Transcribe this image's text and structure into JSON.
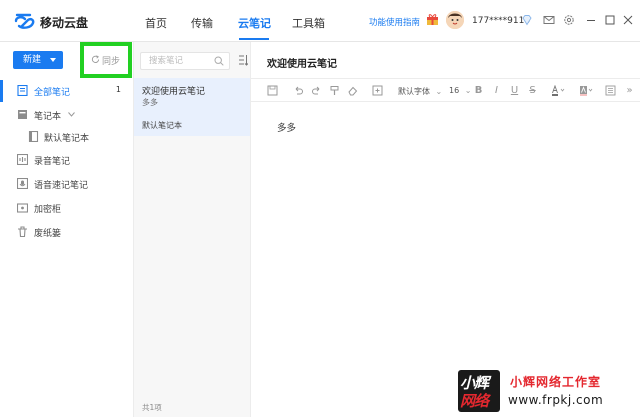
{
  "app": {
    "title": "移动云盘",
    "tabs": [
      {
        "label": "首页"
      },
      {
        "label": "传输"
      },
      {
        "label": "云笔记"
      },
      {
        "label": "工具箱"
      }
    ],
    "guide_label": "功能使用指南",
    "phone": "177****9116",
    "accent_color": "#1a7bf0"
  },
  "sidebar": {
    "new_label": "新建",
    "sync_label": "同步",
    "items": [
      {
        "label": "全部笔记",
        "count": "1"
      },
      {
        "label": "笔记本"
      },
      {
        "label": "默认笔记本"
      },
      {
        "label": "录音笔记"
      },
      {
        "label": "语音速记笔记"
      },
      {
        "label": "加密柜"
      },
      {
        "label": "废纸篓"
      }
    ]
  },
  "list": {
    "search_placeholder": "搜索笔记",
    "notes": [
      {
        "title": "欢迎使用云笔记",
        "preview": "多多",
        "notebook": "默认笔记本"
      }
    ],
    "footer": "共1项"
  },
  "editor": {
    "title": "欢迎使用云笔记",
    "font": "默认字体",
    "size": "16",
    "body": "多多"
  },
  "watermark": {
    "logo_top": "小辉",
    "logo_bottom": "网络",
    "name": "小辉网络工作室",
    "url": "www.frpkj.com"
  }
}
